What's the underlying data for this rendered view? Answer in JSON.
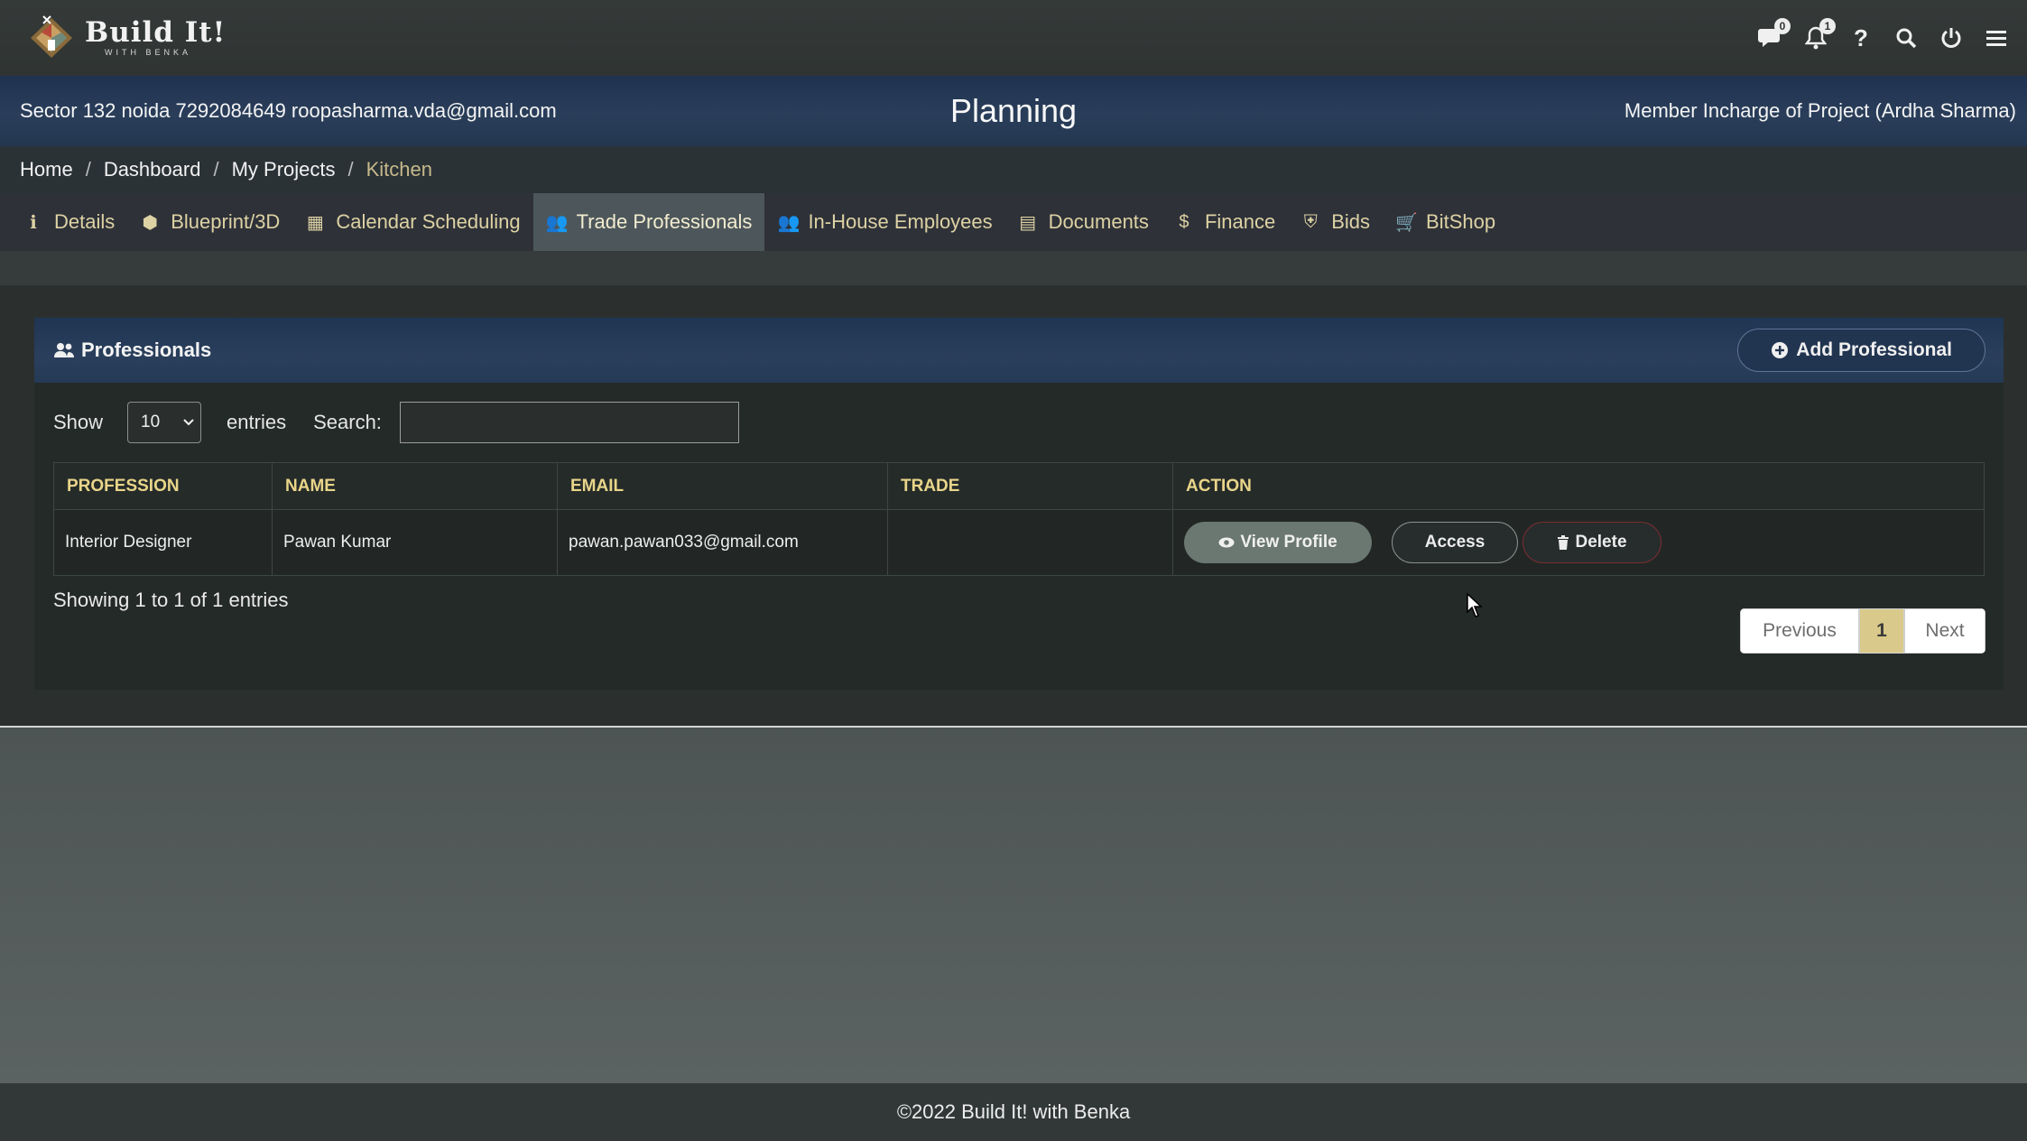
{
  "brand": {
    "title": "Build It!",
    "subtitle": "WITH BENKA"
  },
  "topbar": {
    "chat_badge": "0",
    "bell_badge": "1",
    "icons": [
      "chat-icon",
      "bell-icon",
      "help-icon",
      "search-icon",
      "power-icon",
      "menu-icon"
    ]
  },
  "project": {
    "address_contact": "Sector 132 noida 7292084649 roopasharma.vda@gmail.com",
    "stage": "Planning",
    "member": "Member Incharge of Project (Ardha Sharma)"
  },
  "breadcrumb": [
    "Home",
    "Dashboard",
    "My Projects",
    "Kitchen"
  ],
  "tabs": [
    {
      "label": "Details",
      "icon": "info-icon"
    },
    {
      "label": "Blueprint/3D",
      "icon": "cubes-icon"
    },
    {
      "label": "Calendar Scheduling",
      "icon": "calendar-icon"
    },
    {
      "label": "Trade Professionals",
      "icon": "users-icon",
      "active": true
    },
    {
      "label": "In-House Employees",
      "icon": "users-icon"
    },
    {
      "label": "Documents",
      "icon": "file-icon"
    },
    {
      "label": "Finance",
      "icon": "dollar-icon"
    },
    {
      "label": "Bids",
      "icon": "shield-icon"
    },
    {
      "label": "BitShop",
      "icon": "cart-icon"
    }
  ],
  "card": {
    "title": "Professionals",
    "add_button": "Add Professional"
  },
  "controls": {
    "show_label": "Show",
    "page_size": "10",
    "entries_label": "entries",
    "search_label": "Search:",
    "search_value": ""
  },
  "table": {
    "columns": [
      "PROFESSION",
      "NAME",
      "EMAIL",
      "TRADE",
      "ACTION"
    ],
    "rows": [
      {
        "profession": "Interior Designer",
        "name": "Pawan Kumar",
        "email": "pawan.pawan033@gmail.com",
        "trade": ""
      }
    ],
    "actions": {
      "view": "View Profile",
      "access": "Access",
      "delete": "Delete"
    }
  },
  "pagination": {
    "summary": "Showing 1 to 1 of 1 entries",
    "previous": "Previous",
    "current": "1",
    "next": "Next"
  },
  "footer": {
    "copyright": "©2022 Build It! with Benka"
  },
  "colors": {
    "accent_gold": "#e9d58a",
    "header_blue": "#233a58",
    "active_tab": "#4d575b"
  }
}
